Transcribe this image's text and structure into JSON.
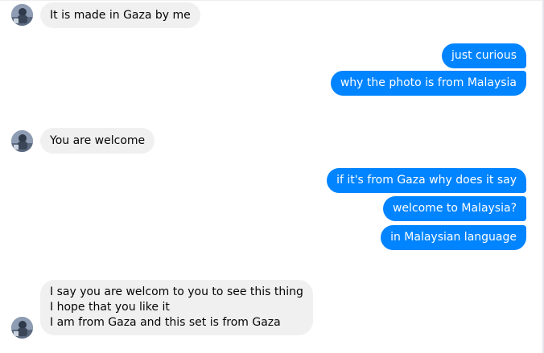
{
  "conversation": {
    "messages": [
      {
        "from": "them",
        "text": "It is made in Gaza by me"
      },
      {
        "from": "me",
        "text": "just curious"
      },
      {
        "from": "me",
        "text": "why the photo is from Malaysia"
      },
      {
        "from": "them",
        "text": "You are welcome"
      },
      {
        "from": "me",
        "text": "if it's from Gaza why does it say"
      },
      {
        "from": "me",
        "text": "welcome to Malaysia?"
      },
      {
        "from": "me",
        "text": "in Malaysian language"
      },
      {
        "from": "them",
        "lines": [
          "I say you are welcom to you to see this thing",
          "I hope that you like it",
          "I am from Gaza and this set is from Gaza"
        ]
      }
    ]
  },
  "colors": {
    "outgoing_bubble": "#0084ff",
    "incoming_bubble": "#f1f0f0"
  },
  "icons": {
    "contact_avatar": "avatar-photo-icon"
  }
}
